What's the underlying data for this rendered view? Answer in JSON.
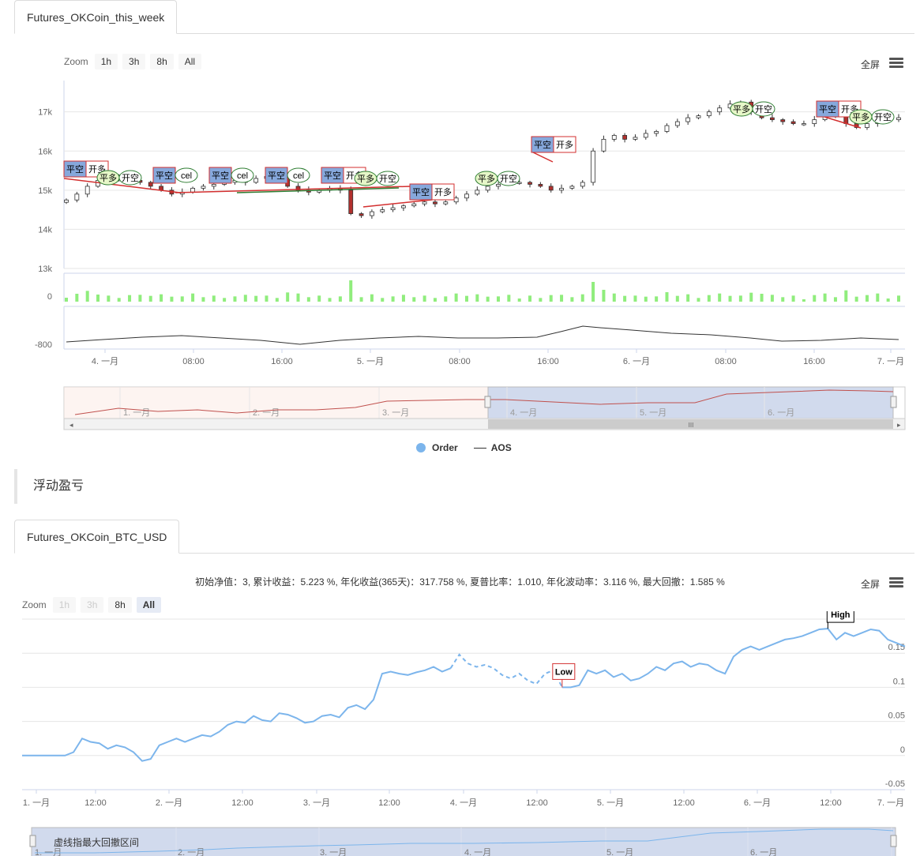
{
  "tabs": {
    "top": "Futures_OKCoin_this_week",
    "bottom": "Futures_OKCoin_BTC_USD"
  },
  "zoom": {
    "label": "Zoom",
    "top_buttons": [
      "1h",
      "3h",
      "8h",
      "All"
    ],
    "bottom_buttons": [
      "1h",
      "3h",
      "8h",
      "All"
    ],
    "bottom_active": "All"
  },
  "fullscreen_label": "全屏",
  "legend": {
    "order": "Order",
    "aos": "AOS"
  },
  "section_title": "浮动盈亏",
  "stats_line": "初始净值：3, 累计收益：5.223 %, 年化收益(365天)：317.758 %, 夏普比率：1.010, 年化波动率：3.116 %, 最大回撤：1.585 %",
  "navigator_note": "虚线指最大回撤区间",
  "colors": {
    "up": "#ffffff",
    "down": "#b2302d",
    "volume": "#90ed7d",
    "equity": "#7cb5ec",
    "navigator_fill": "rgba(102,133,194,0.3)"
  },
  "chart_data": [
    {
      "type": "candlestick",
      "name": "Futures_OKCoin_this_week",
      "y_ticks": [
        "17k",
        "16k",
        "15k",
        "14k",
        "13k"
      ],
      "ylim": [
        13000,
        17800
      ],
      "x_ticks": [
        "4. 一月",
        "08:00",
        "16:00",
        "5. 一月",
        "08:00",
        "16:00",
        "6. 一月",
        "08:00",
        "16:00",
        "7. 一月"
      ],
      "close_values": [
        14750,
        14900,
        15100,
        15250,
        15300,
        15350,
        15250,
        15200,
        15100,
        15000,
        14900,
        14950,
        15050,
        15100,
        15150,
        15200,
        15250,
        15200,
        15300,
        15350,
        15300,
        15100,
        15000,
        14950,
        15000,
        15050,
        15000,
        14400,
        14350,
        14450,
        14500,
        14550,
        14600,
        14650,
        14700,
        14650,
        14700,
        14800,
        14900,
        15000,
        15100,
        15150,
        15200,
        15200,
        15150,
        15100,
        15000,
        15050,
        15100,
        15200,
        16000,
        16300,
        16400,
        16300,
        16350,
        16450,
        16500,
        16650,
        16750,
        16850,
        16900,
        17000,
        17100,
        17200,
        17250,
        17000,
        16850,
        16800,
        16750,
        16700,
        16700,
        16800,
        16900,
        16950,
        16700,
        16600,
        16700,
        16800,
        16800,
        16850
      ],
      "order_flags": [
        "平空",
        "开多",
        "平多",
        "开空",
        "平空",
        "cel",
        "平空",
        "cel",
        "平空",
        "cel",
        "平空",
        "开多",
        "平多",
        "开空",
        "平空",
        "开多",
        "平多",
        "开空",
        "平空",
        "开多",
        "平多",
        "开空",
        "平空",
        "开多",
        "平多",
        "开空"
      ],
      "volume_tick": "0",
      "aos_tick": "-800"
    },
    {
      "type": "line",
      "name": "浮动盈亏",
      "x_ticks": [
        "1. 一月",
        "12:00",
        "2. 一月",
        "12:00",
        "3. 一月",
        "12:00",
        "4. 一月",
        "12:00",
        "5. 一月",
        "12:00",
        "6. 一月",
        "12:00",
        "7. 一月"
      ],
      "y_ticks": [
        "0.15",
        "0.1",
        "0.05",
        "0",
        "-0.05"
      ],
      "ylim": [
        -0.05,
        0.2
      ],
      "values": [
        0,
        0,
        0,
        0,
        0,
        0,
        0.005,
        0.025,
        0.02,
        0.018,
        0.01,
        0.015,
        0.012,
        0.005,
        -0.008,
        -0.005,
        0.015,
        0.02,
        0.025,
        0.02,
        0.025,
        0.03,
        0.028,
        0.035,
        0.045,
        0.05,
        0.048,
        0.058,
        0.052,
        0.05,
        0.062,
        0.06,
        0.055,
        0.048,
        0.05,
        0.058,
        0.06,
        0.056,
        0.07,
        0.074,
        0.068,
        0.082,
        0.12,
        0.123,
        0.12,
        0.118,
        0.122,
        0.125,
        0.13,
        0.123,
        0.128,
        0.148,
        0.135,
        0.13,
        0.133,
        0.128,
        0.118,
        0.113,
        0.12,
        0.11,
        0.105,
        0.12,
        0.125,
        0.1,
        0.1,
        0.103,
        0.125,
        0.12,
        0.125,
        0.115,
        0.12,
        0.11,
        0.113,
        0.12,
        0.13,
        0.125,
        0.135,
        0.138,
        0.13,
        0.135,
        0.133,
        0.125,
        0.12,
        0.145,
        0.155,
        0.16,
        0.155,
        0.16,
        0.165,
        0.17,
        0.172,
        0.175,
        0.18,
        0.185,
        0.186,
        0.17,
        0.18,
        0.175,
        0.18,
        0.185,
        0.183,
        0.17,
        0.165,
        0.16
      ],
      "drawdown_range": [
        50,
        63
      ],
      "annotations": {
        "high": "High",
        "low": "Low"
      }
    }
  ]
}
